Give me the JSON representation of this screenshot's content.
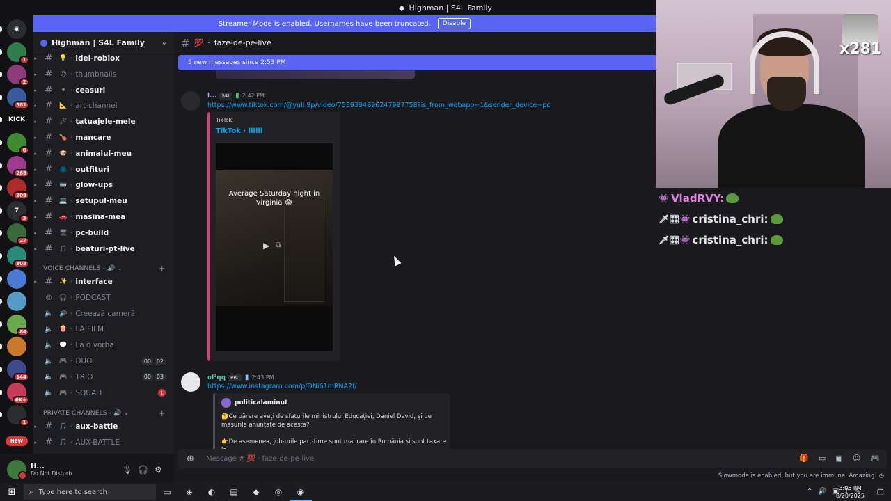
{
  "window": {
    "title": "Highman | S4L Family"
  },
  "banner": {
    "text": "Streamer Mode is enabled. Usernames have been truncated.",
    "button": "Disable"
  },
  "rail": {
    "servers": [
      {
        "icon": "discord-icon",
        "color": "#2b2d31",
        "glyph": "◉",
        "badge": ""
      },
      {
        "icon": "server-avatar",
        "color": "#2f7d4a",
        "glyph": "",
        "badge": "1"
      },
      {
        "icon": "server-avatar",
        "color": "#8e3a7a",
        "glyph": "",
        "badge": "2"
      },
      {
        "icon": "server-avatar",
        "color": "#3a5a9e",
        "glyph": "",
        "badge": "581"
      },
      {
        "icon": "kick-icon",
        "color": "#101010",
        "glyph": "KICK",
        "badge": ""
      },
      {
        "icon": "server-avatar",
        "color": "#3d8a2f",
        "glyph": "",
        "badge": "6"
      },
      {
        "icon": "server-avatar",
        "color": "#a03a8e",
        "glyph": "",
        "badge": "268"
      },
      {
        "icon": "server-avatar",
        "color": "#b12a2a",
        "glyph": "",
        "badge": "308"
      },
      {
        "icon": "server-avatar",
        "color": "#2b2d31",
        "glyph": "7",
        "badge": "3"
      },
      {
        "icon": "server-avatar",
        "color": "#3a6a3a",
        "glyph": "",
        "badge": "27"
      },
      {
        "icon": "server-avatar",
        "color": "#2a8a7a",
        "glyph": "",
        "badge": "303"
      },
      {
        "icon": "server-avatar",
        "color": "#4a7ad8",
        "glyph": "",
        "badge": ""
      },
      {
        "icon": "server-avatar",
        "color": "#5a9ac8",
        "glyph": "",
        "badge": ""
      },
      {
        "icon": "server-avatar",
        "color": "#6aaa4a",
        "glyph": "",
        "badge": "84"
      },
      {
        "icon": "server-avatar",
        "color": "#c87a2a",
        "glyph": "",
        "badge": ""
      },
      {
        "icon": "server-avatar",
        "color": "#3a4a8a",
        "glyph": "",
        "badge": "144"
      },
      {
        "icon": "server-avatar",
        "color": "#c83a5a",
        "glyph": "",
        "badge": "6K+"
      },
      {
        "icon": "server-avatar",
        "color": "#2b2d31",
        "glyph": "",
        "badge": "1"
      }
    ],
    "new_label": "NEW"
  },
  "server": {
    "name": "Highman | S4L Family"
  },
  "channels": [
    {
      "type": "text",
      "emoji": "💡",
      "name": "idei-roblox",
      "unread": true,
      "arrow": true
    },
    {
      "type": "text",
      "emoji": "😕",
      "name": "thumbnails",
      "unread": false,
      "arrow": true
    },
    {
      "type": "text",
      "emoji": "⚫",
      "name": "ceasuri",
      "unread": true,
      "arrow": true
    },
    {
      "type": "text",
      "emoji": "📐",
      "name": "art-channel",
      "unread": false,
      "arrow": true
    },
    {
      "type": "text",
      "emoji": "🖊",
      "name": "tatuajele-mele",
      "unread": true,
      "arrow": true
    },
    {
      "type": "text",
      "emoji": "🍗",
      "name": "mancare",
      "unread": true,
      "arrow": true
    },
    {
      "type": "text",
      "emoji": "🐶",
      "name": "animalul-meu",
      "unread": true,
      "arrow": true
    },
    {
      "type": "text",
      "emoji": "🧥",
      "name": "outfituri",
      "unread": true,
      "arrow": true
    },
    {
      "type": "text",
      "emoji": "🥽",
      "name": "glow-ups",
      "unread": true,
      "arrow": true
    },
    {
      "type": "text",
      "emoji": "💻",
      "name": "setupul-meu",
      "unread": true,
      "arrow": true
    },
    {
      "type": "text",
      "emoji": "🚗",
      "name": "masina-mea",
      "unread": true,
      "arrow": true
    },
    {
      "type": "text",
      "emoji": "🖥",
      "name": "pc-build",
      "unread": true,
      "arrow": true
    },
    {
      "type": "text",
      "emoji": "🎵",
      "name": "beaturi-pt-live",
      "unread": true,
      "arrow": true
    }
  ],
  "voice_category": {
    "label": "VOICE CHANNELS - 🔊 ⌄"
  },
  "voice_channels": [
    {
      "type": "text",
      "emoji": "✨",
      "name": "interface",
      "unread": true,
      "arrow": true,
      "count": "",
      "count2": "",
      "red": ""
    },
    {
      "type": "stage",
      "emoji": "🎧",
      "name": "PODCAST",
      "unread": false,
      "arrow": false,
      "count": "",
      "count2": "",
      "red": ""
    },
    {
      "type": "voice",
      "emoji": "🔊",
      "name": "Creează cameră",
      "unread": false,
      "arrow": false,
      "count": "",
      "count2": "",
      "red": ""
    },
    {
      "type": "voice",
      "emoji": "🍿",
      "name": "LA FILM",
      "unread": false,
      "arrow": false,
      "count": "",
      "count2": "",
      "red": ""
    },
    {
      "type": "voice",
      "emoji": "💬",
      "name": "La o vorbă",
      "unread": false,
      "arrow": false,
      "count": "",
      "count2": "",
      "red": ""
    },
    {
      "type": "voice",
      "emoji": "🎮",
      "name": "DUO",
      "unread": false,
      "arrow": false,
      "count": "02",
      "count2": "00",
      "red": ""
    },
    {
      "type": "voice",
      "emoji": "🎮",
      "name": "TRIO",
      "unread": false,
      "arrow": false,
      "count": "03",
      "count2": "00",
      "red": ""
    },
    {
      "type": "voice",
      "emoji": "🎮",
      "name": "SQUAD",
      "unread": false,
      "arrow": false,
      "count": "",
      "count2": "",
      "red": "1"
    }
  ],
  "private_category": {
    "label": "PRIVATE CHANNELS - 🔊 ⌄"
  },
  "private_channels": [
    {
      "type": "text",
      "emoji": "🎵",
      "name": "aux-battle",
      "unread": true,
      "arrow": true
    },
    {
      "type": "text",
      "emoji": "🎵",
      "name": "AUX-BATTLE",
      "unread": false,
      "arrow": true
    }
  ],
  "user": {
    "name": "H...",
    "status": "Do Not Disturb"
  },
  "channel": {
    "emoji": "💯",
    "name": "faze-de-pe-live",
    "new_messages": "5 new messages since 2:53 PM"
  },
  "messages": [
    {
      "author": "l...",
      "tag": "S4L",
      "time": "2:42 PM",
      "link": "https://www.tiktok.com/@yuli.9p/video/7539394896247997758?is_from_webapp=1&sender_device=pc",
      "embed": {
        "provider": "TikTok",
        "title": "TikTok · llllll",
        "caption": "Average Saturday night in Virginia 😂"
      }
    },
    {
      "author": "αl¹ηη",
      "tag": "PBC",
      "time": "2:43 PM",
      "link": "https://www.instagram.com/p/DNi61mRNA2f/",
      "embed": {
        "name": "politicalaminut",
        "line1": "🤔Ce părere aveți de sfaturile ministrului Educației, Daniel David, și de măsurile anunțate de acesta?",
        "line2": "👉De asemenea, job-urile part-time sunt mai rare în România și sunt taxare la"
      }
    }
  ],
  "composer": {
    "placeholder": "Message # 💯 · faze-de-pe-live"
  },
  "slowmode": "Slowmode is enabled, but you are immune. Amazing!",
  "webcam": {
    "gift_count": "x281"
  },
  "chat_overlay": [
    {
      "badges": "👾",
      "name": "VladRVY:",
      "color": "#e07fe0"
    },
    {
      "badges": "🗡🎛👾",
      "name": "cristina_chri:",
      "color": "#e6e6e6"
    },
    {
      "badges": "🗡🎛👾",
      "name": "cristina_chri:",
      "color": "#e6e6e6"
    }
  ],
  "taskbar": {
    "search": "Type here to search",
    "time": "3:06 PM",
    "date": "8/20/2025"
  }
}
